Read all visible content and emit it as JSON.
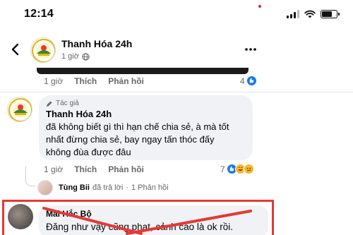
{
  "status_bar": {
    "time": "12:14",
    "icons": [
      "signal-icon",
      "wifi-icon",
      "battery-icon"
    ]
  },
  "header": {
    "page_name": "Thanh Hóa 24h",
    "meta_time": "1 giờ",
    "meta_icon": "globe-icon",
    "back_icon": "chevron-left-icon",
    "more_icon": "more-horizontal-icon"
  },
  "post_actions": {
    "time": "1 giờ",
    "like": "Thích",
    "reply": "Phản hồi",
    "reaction_count": "4"
  },
  "comment": {
    "author_tag": "Tác giả",
    "author": "Thanh Hóa 24h",
    "lines": [
      "đã không biết gì thì hạn chế chia sẻ, à mà tốt",
      "nhất đừng chia sẻ, bay ngay tấn thóc đấy",
      "không đùa được đâu"
    ],
    "time": "1 giờ",
    "like": "Thích",
    "reply": "Phản hồi",
    "reaction_count": "7"
  },
  "reply_summary": {
    "name": "Tùng Bii",
    "action": "đã trả lời",
    "separator": "·",
    "count": "1 Phản hồi"
  },
  "highlighted_comment": {
    "author": "Mai Hắc Bộ",
    "text": "Đăng như vậy cũng phạt, cảnh cáo là ok rồi."
  },
  "colors": {
    "accent_red": "#e53935",
    "like_blue": "#1877f2",
    "haha_yellow": "#f7b928",
    "secondary_text": "#65676b",
    "bubble_bg": "#f0f2f5"
  }
}
